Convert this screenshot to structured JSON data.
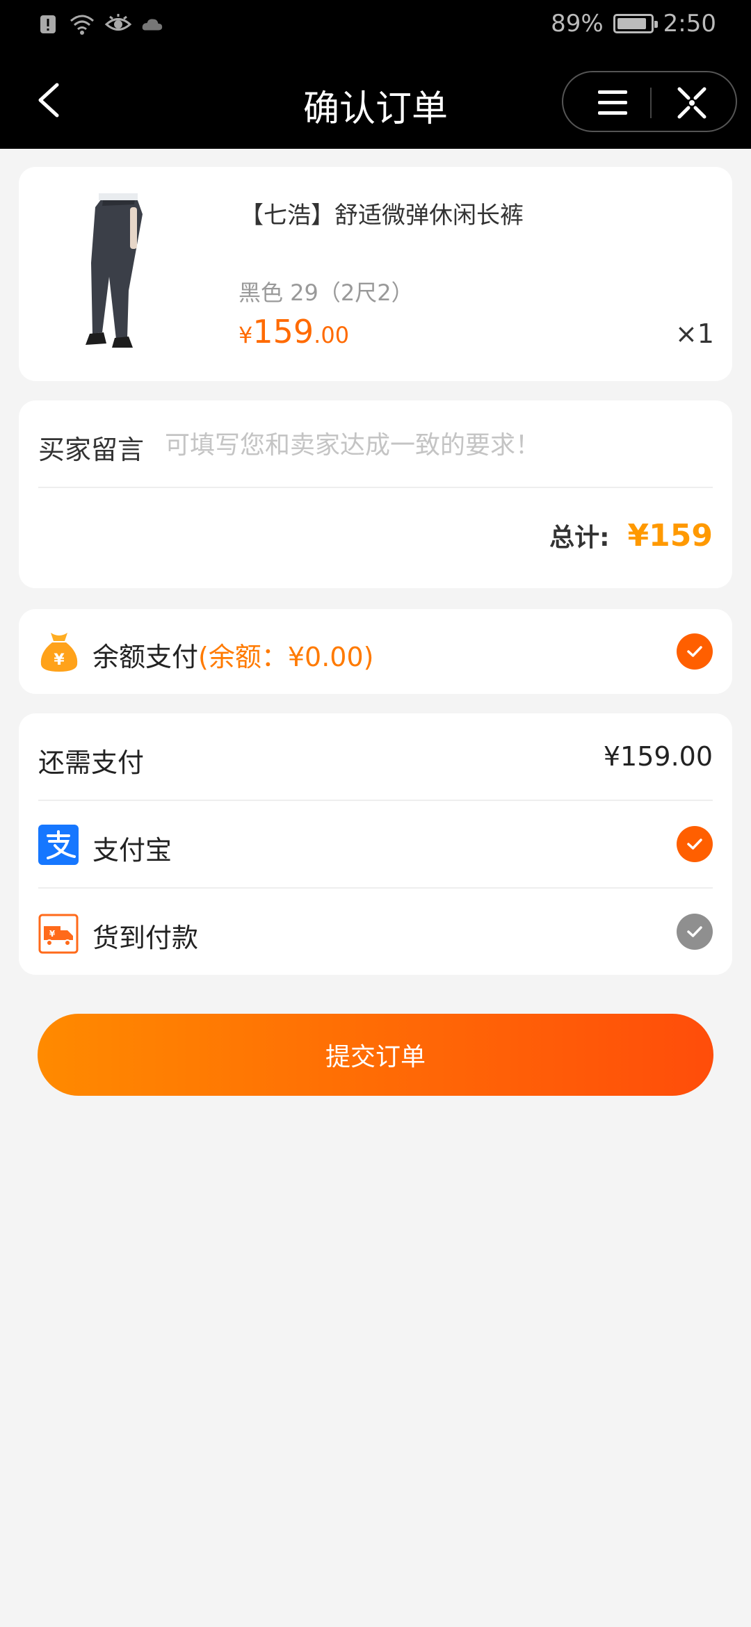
{
  "status_bar": {
    "battery": "89%",
    "battery_level": 0.89,
    "time": "2:50"
  },
  "header": {
    "title": "确认订单"
  },
  "product": {
    "title": "【七浩】舒适微弹休闲长裤",
    "spec": "黑色 29（2尺2）",
    "price_currency": "¥",
    "price_int": "159",
    "price_dec": ".00",
    "quantity": "×1"
  },
  "message": {
    "label": "买家留言",
    "placeholder": "可填写您和卖家达成一致的要求！",
    "value": ""
  },
  "total": {
    "label": "总计:",
    "value": "¥159"
  },
  "balance": {
    "label": "余额支付",
    "extra": "(余额：¥0.00)",
    "checked": true
  },
  "payment": {
    "due_label": "还需支付",
    "due_value": "¥159.00",
    "methods": [
      {
        "label": "支付宝",
        "icon": "alipay-icon",
        "checked": true
      },
      {
        "label": "货到付款",
        "icon": "delivery-truck-icon",
        "checked": false
      }
    ]
  },
  "submit": {
    "label": "提交订单"
  },
  "colors": {
    "accent": "#ff5f00",
    "price": "#ff6a00",
    "total": "#ff9900",
    "alipay": "#1677ff"
  }
}
